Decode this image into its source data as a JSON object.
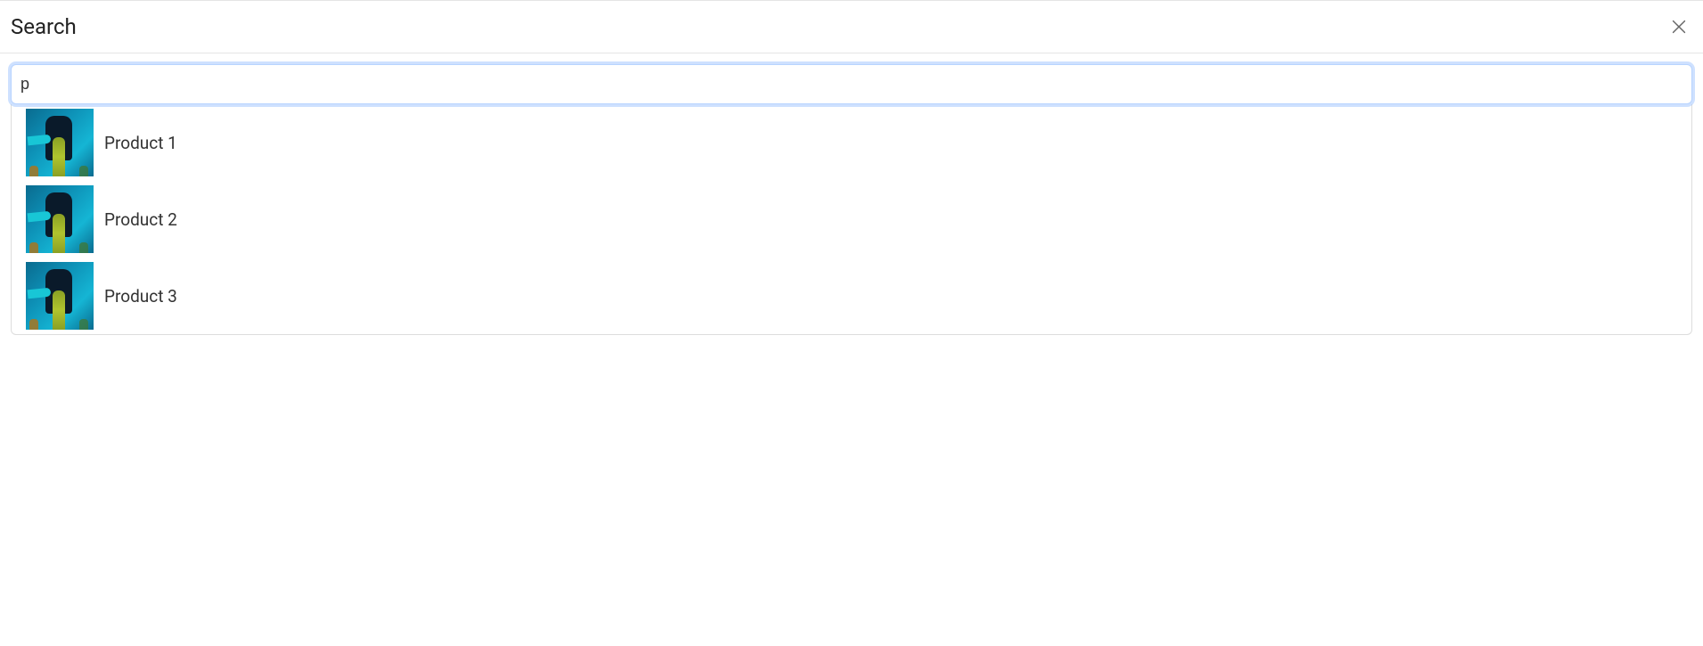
{
  "header": {
    "title": "Search"
  },
  "search": {
    "value": "p",
    "placeholder": ""
  },
  "results": [
    {
      "label": "Product 1",
      "thumb_alt": "scuba-diver-thumbnail"
    },
    {
      "label": "Product 2",
      "thumb_alt": "scuba-diver-thumbnail"
    },
    {
      "label": "Product 3",
      "thumb_alt": "scuba-diver-thumbnail"
    }
  ]
}
